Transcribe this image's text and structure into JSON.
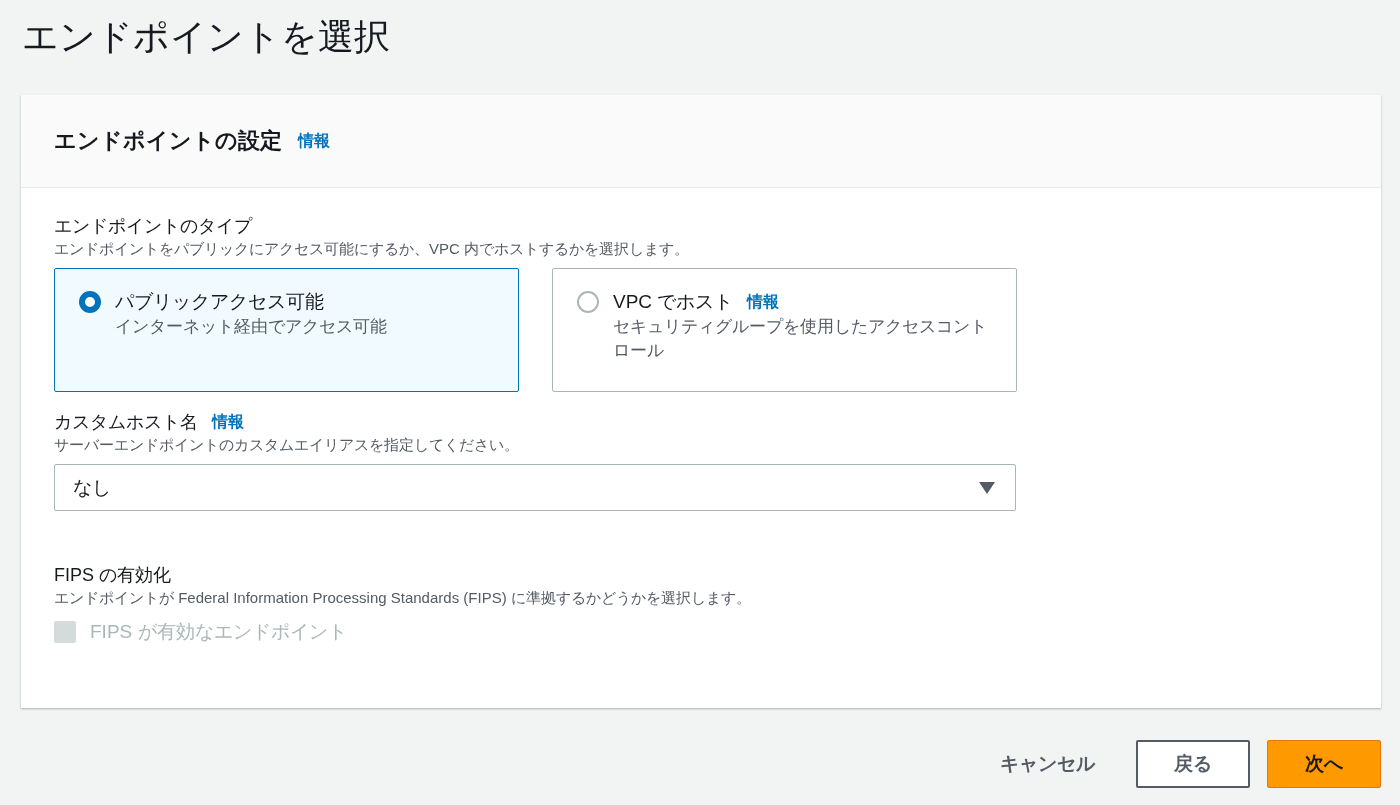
{
  "page_title": "エンドポイントを選択",
  "panel": {
    "title": "エンドポイントの設定",
    "info_link": "情報"
  },
  "endpoint_type": {
    "label": "エンドポイントのタイプ",
    "description": "エンドポイントをパブリックにアクセス可能にするか、VPC 内でホストするかを選択します。",
    "options": [
      {
        "title": "パブリックアクセス可能",
        "description": "インターネット経由でアクセス可能",
        "selected": true
      },
      {
        "title": "VPC でホスト",
        "info_link": "情報",
        "description": "セキュリティグループを使用したアクセスコントロール",
        "selected": false
      }
    ]
  },
  "custom_hostname": {
    "label": "カスタムホスト名",
    "info_link": "情報",
    "description": "サーバーエンドポイントのカスタムエイリアスを指定してください。",
    "select": {
      "value": "なし"
    }
  },
  "fips": {
    "label": "FIPS の有効化",
    "description": "エンドポイントが Federal Information Processing Standards (FIPS) に準拠するかどうかを選択します。",
    "checkbox": {
      "label": "FIPS が有効なエンドポイント",
      "checked": false,
      "disabled": true
    }
  },
  "buttons": [
    {
      "label": "キャンセル",
      "kind": "link"
    },
    {
      "label": "戻る",
      "kind": "normal"
    },
    {
      "label": "次へ",
      "kind": "primary"
    }
  ]
}
